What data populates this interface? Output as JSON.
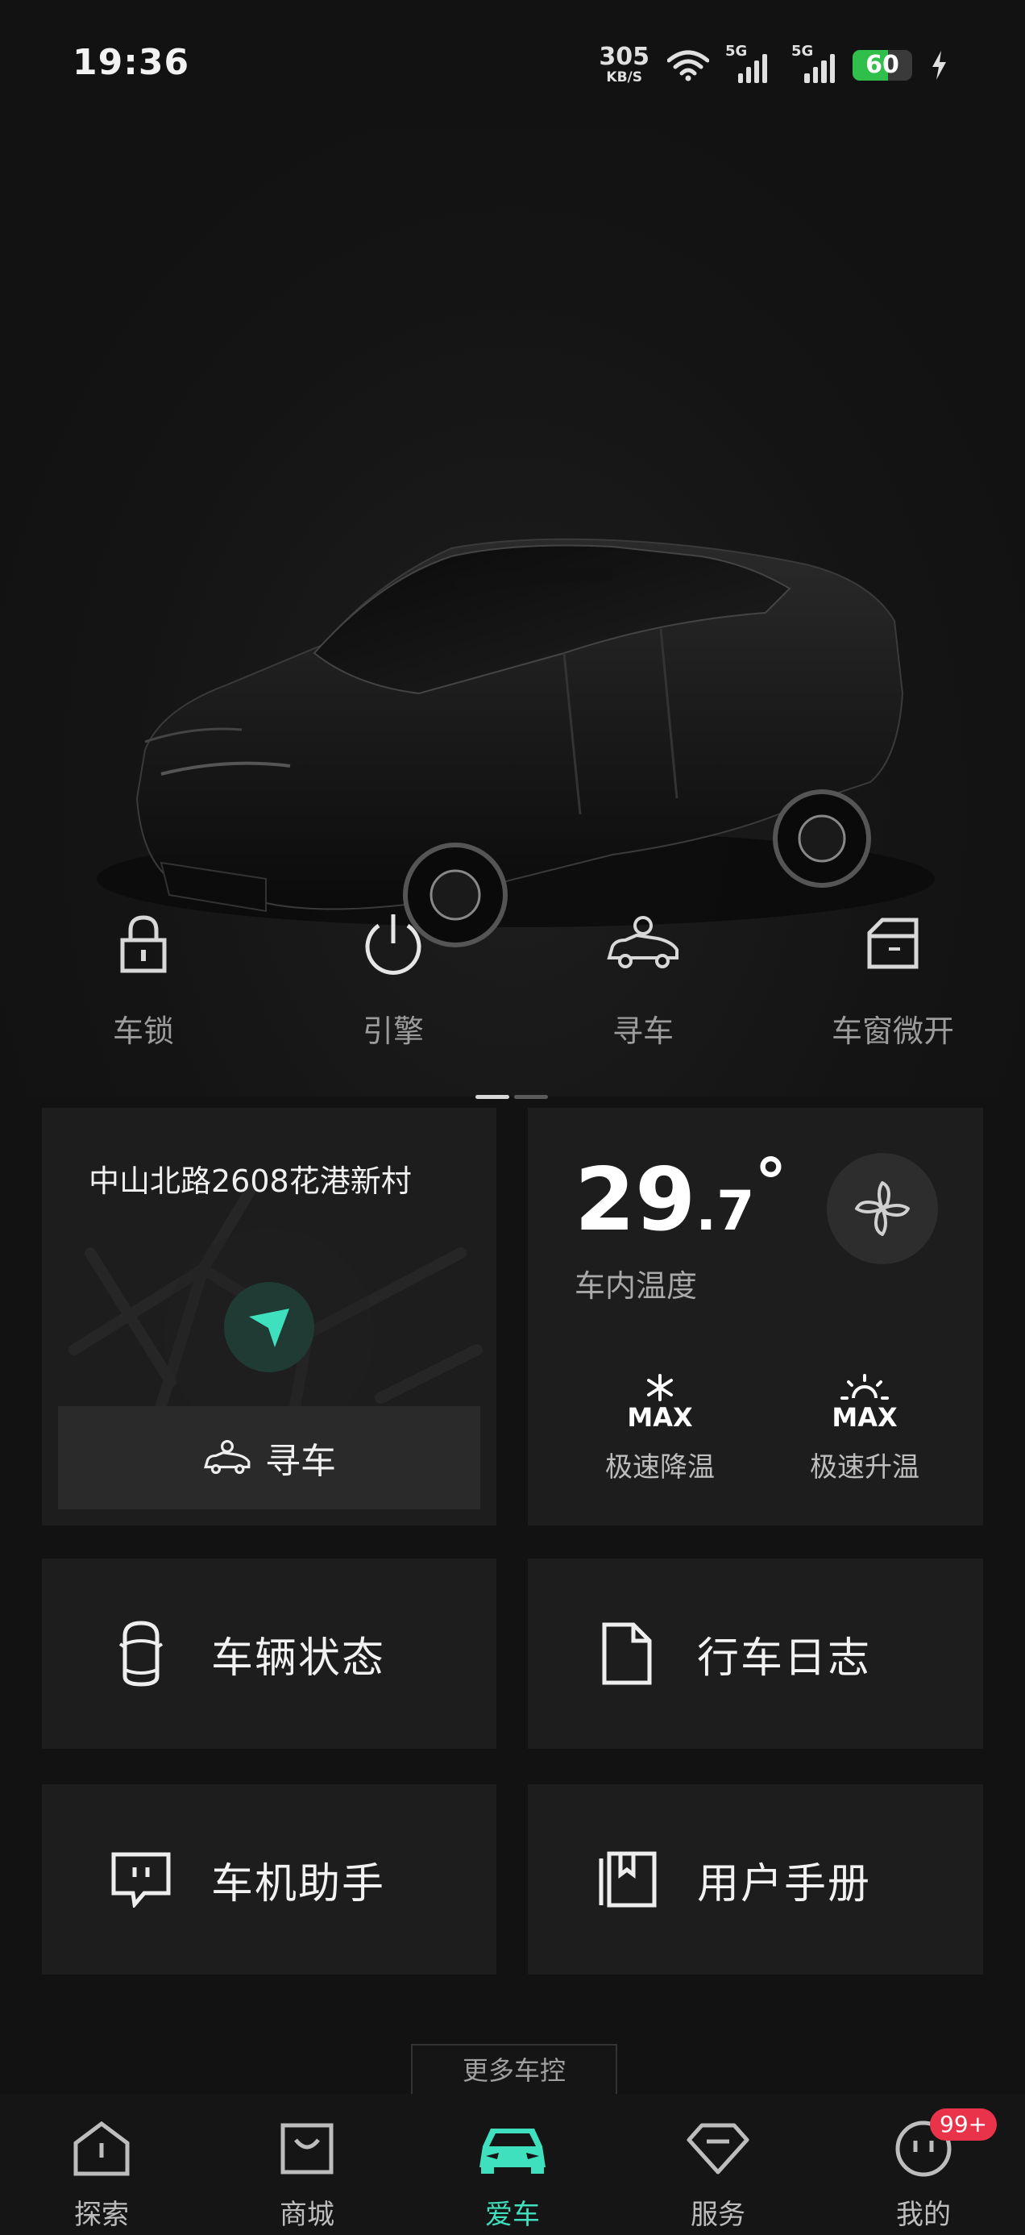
{
  "status_bar": {
    "time": "19:36",
    "net_speed": "305",
    "net_unit": "KB/S",
    "signal1": "5G",
    "signal2": "5G",
    "battery": "60",
    "battery_level": 0.6
  },
  "quick_actions": [
    {
      "icon": "lock-icon",
      "label": "车锁"
    },
    {
      "icon": "power-icon",
      "label": "引擎"
    },
    {
      "icon": "find-car-icon",
      "label": "寻车"
    },
    {
      "icon": "window-icon",
      "label": "车窗微开"
    }
  ],
  "location_card": {
    "address": "中山北路2608花港新村",
    "find_button": "寻车"
  },
  "temperature_card": {
    "integer": "29",
    "decimal": ".7",
    "unit": "°",
    "label": "车内温度",
    "cool": {
      "badge": "MAX",
      "label": "极速降温"
    },
    "heat": {
      "badge": "MAX",
      "label": "极速升温"
    }
  },
  "tiles": [
    {
      "icon": "car-top-icon",
      "label": "车辆状态"
    },
    {
      "icon": "document-icon",
      "label": "行车日志"
    },
    {
      "icon": "chat-assistant-icon",
      "label": "车机助手"
    },
    {
      "icon": "book-icon",
      "label": "用户手册"
    }
  ],
  "more_controls": "更多车控",
  "tabbar": [
    {
      "icon": "explore-icon",
      "label": "探索"
    },
    {
      "icon": "shop-icon",
      "label": "商城"
    },
    {
      "icon": "car-front-icon",
      "label": "爱车",
      "active": true
    },
    {
      "icon": "service-icon",
      "label": "服务"
    },
    {
      "icon": "profile-icon",
      "label": "我的",
      "badge": "99+"
    }
  ],
  "colors": {
    "accent": "#3fe0bd",
    "background": "#121212",
    "card": "#1d1d1d",
    "badge": "#e8334a"
  }
}
